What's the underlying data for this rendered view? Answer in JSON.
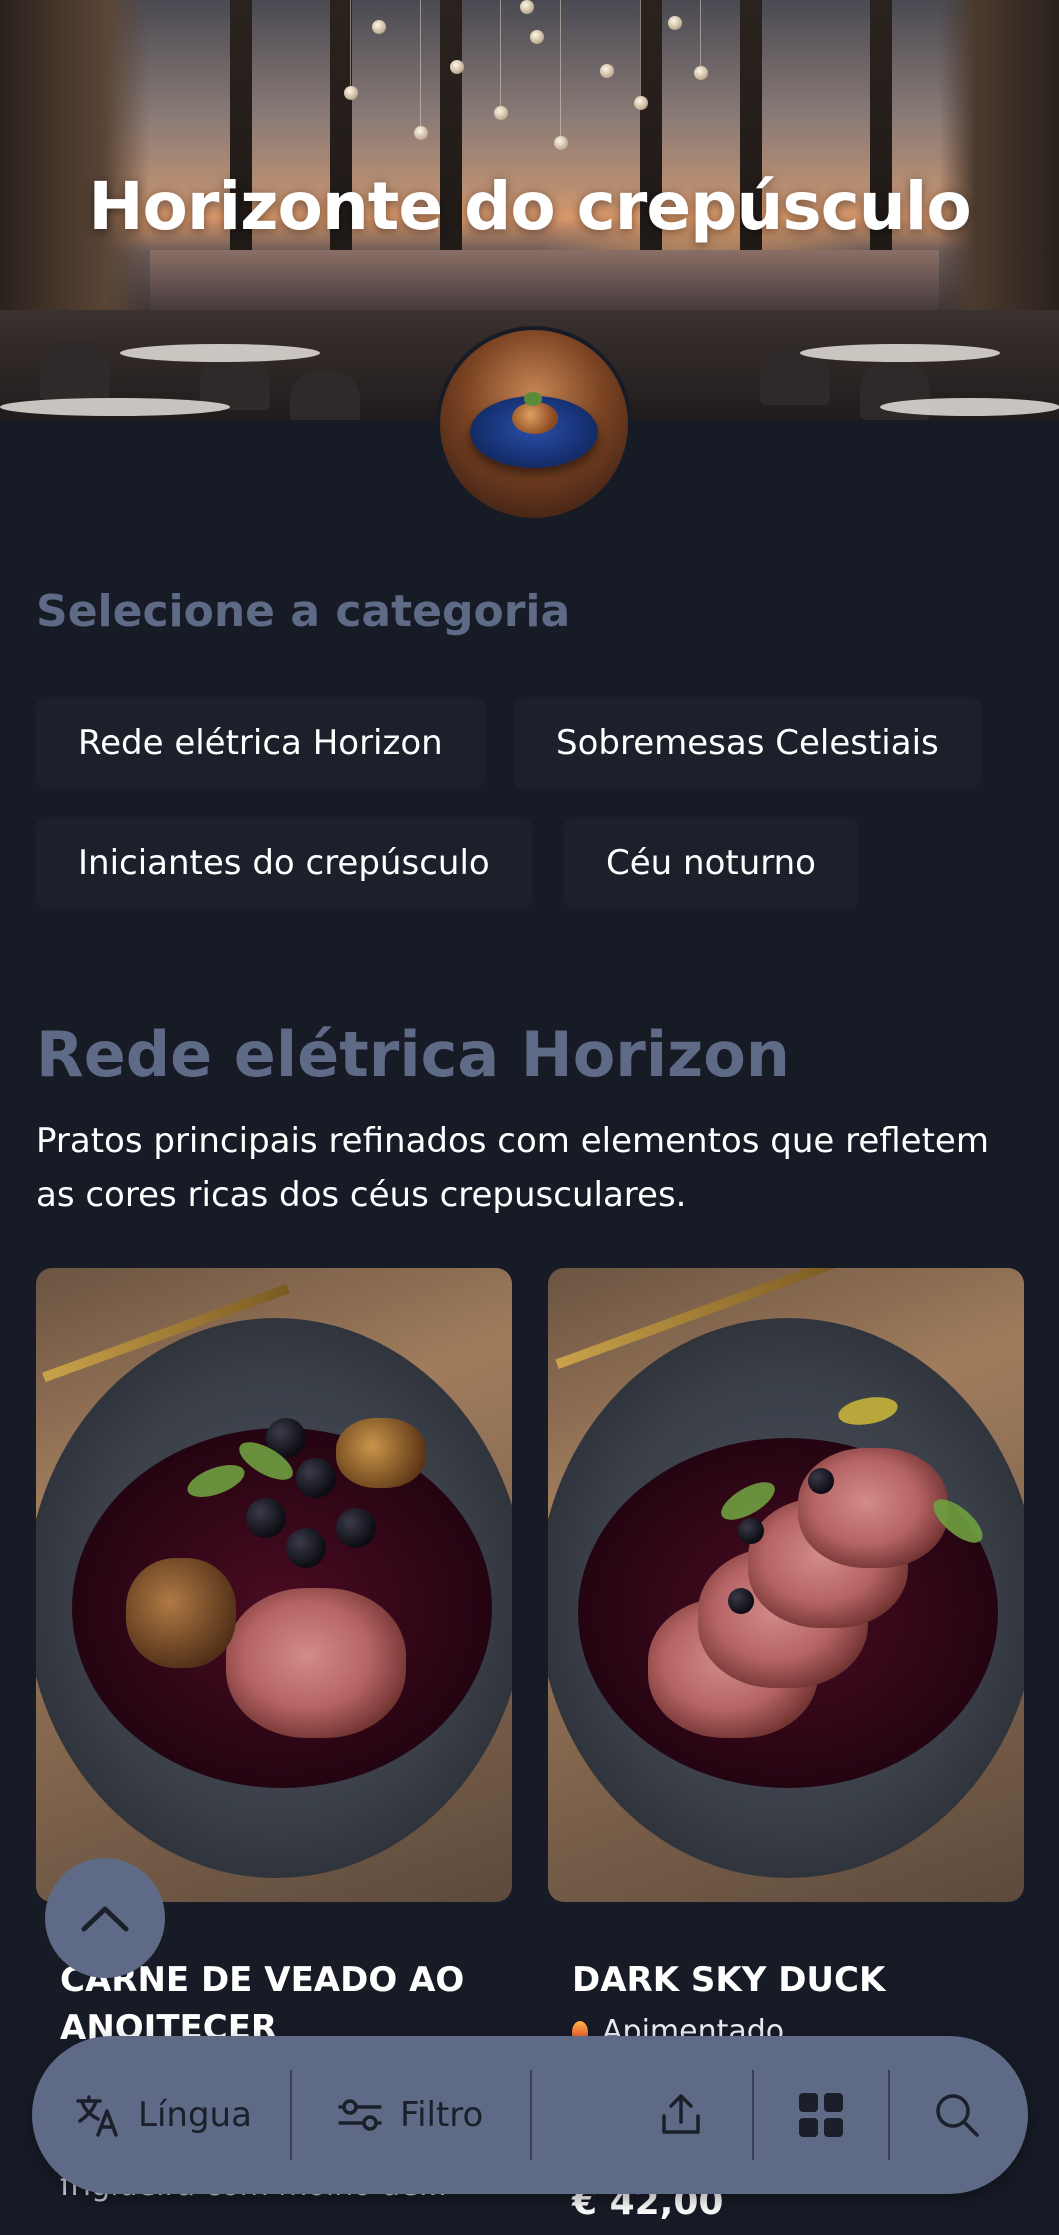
{
  "hero": {
    "title": "Horizonte do crepúsculo"
  },
  "categories": {
    "heading": "Selecione a categoria",
    "items": [
      {
        "label": "Rede elétrica Horizon"
      },
      {
        "label": "Sobremesas Celestiais"
      },
      {
        "label": "Iniciantes do crepúsculo"
      },
      {
        "label": "Céu noturno"
      }
    ]
  },
  "section": {
    "title": "Rede elétrica Horizon",
    "description": "Pratos principais refinados com elementos que refletem as cores ricas dos céus crepusculares."
  },
  "dishes": [
    {
      "name": "CARNE DE VEADO AO ANOITECER",
      "description": "frigideira com molho de...",
      "image_icon": "venison-dish"
    },
    {
      "name": "DARK SKY DUCK",
      "badge": "Apimentado",
      "price": "€ 42,00",
      "image_icon": "duck-dish"
    }
  ],
  "toolbar": {
    "language_label": "Língua",
    "filter_label": "Filtro",
    "icons": [
      "translate-icon",
      "filter-icon",
      "share-icon",
      "grid-icon",
      "search-icon"
    ]
  },
  "colors": {
    "background": "#171b26",
    "accent": "#5e6a86",
    "chip_bg": "#1c202b",
    "text": "#ffffff"
  }
}
